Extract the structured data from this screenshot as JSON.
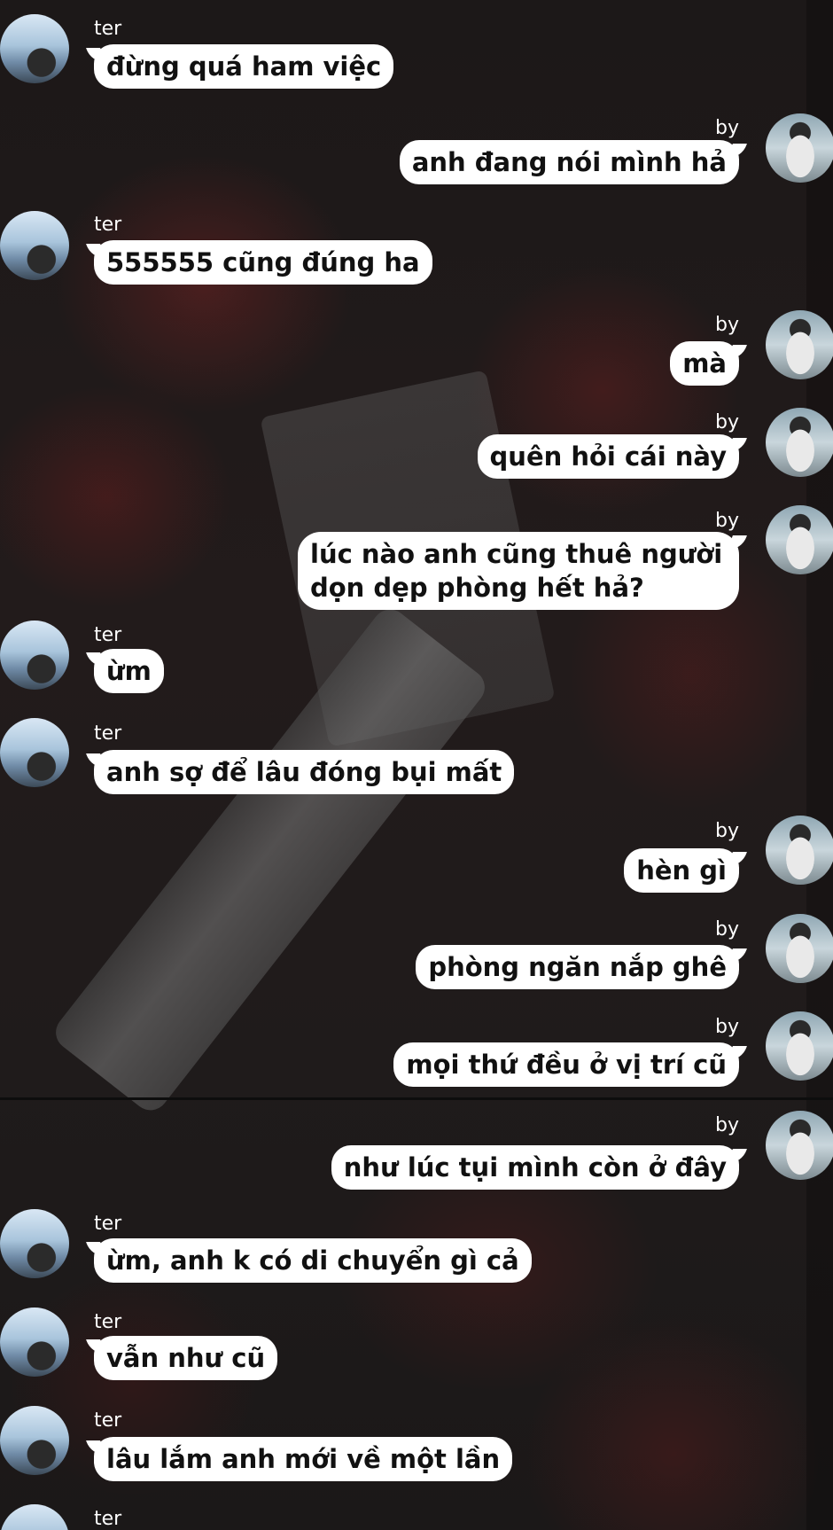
{
  "names": {
    "ter": "ter",
    "by": "by"
  },
  "messages": [
    {
      "from": "ter",
      "text": "đừng quá ham việc"
    },
    {
      "from": "by",
      "text": "anh đang nói mình hả"
    },
    {
      "from": "ter",
      "text": "555555 cũng đúng ha"
    },
    {
      "from": "by",
      "text": "mà"
    },
    {
      "from": "by",
      "text": "quên hỏi cái này"
    },
    {
      "from": "by",
      "text": "lúc nào anh cũng thuê người dọn dẹp phòng hết hả?"
    },
    {
      "from": "ter",
      "text": "ừm"
    },
    {
      "from": "ter",
      "text": "anh sợ để lâu đóng bụi mất"
    },
    {
      "from": "by",
      "text": "hèn gì"
    },
    {
      "from": "by",
      "text": "phòng ngăn nắp ghê"
    },
    {
      "from": "by",
      "text": "mọi thứ đều ở vị trí cũ"
    },
    {
      "from": "by",
      "text": "như lúc tụi mình còn ở đây"
    },
    {
      "from": "ter",
      "text": "ừm, anh k có di chuyển gì cả"
    },
    {
      "from": "ter",
      "text": "vẫn như cũ"
    },
    {
      "from": "ter",
      "text": "lâu lắm anh mới về một lần"
    },
    {
      "from": "ter",
      "text": ""
    }
  ]
}
